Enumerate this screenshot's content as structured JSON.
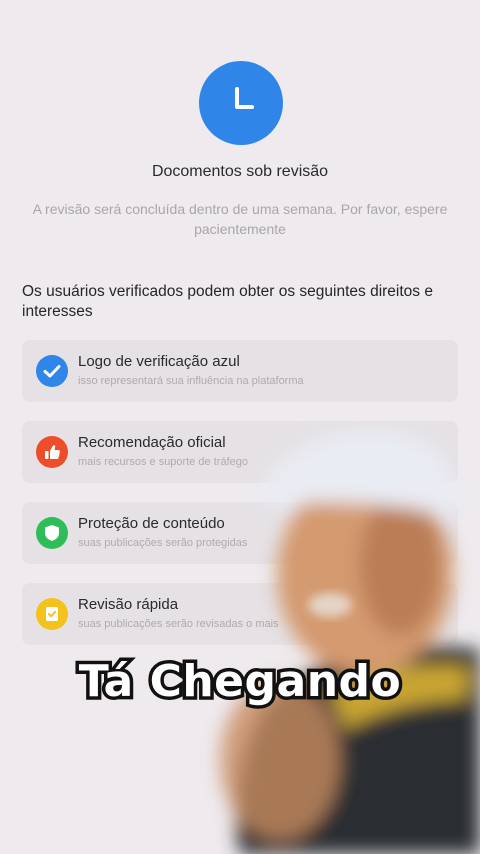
{
  "status": {
    "icon": "clock-icon",
    "title": "Docomentos sob revisão",
    "subtitle": "A revisão será concluída dentro de uma semana. Por favor, espere pacientemente"
  },
  "benefits": {
    "heading": "Os usuários verificados podem obter os seguintes direitos e interesses",
    "items": [
      {
        "icon": "blue-check-icon",
        "color": "#2f86e8",
        "title": "Logo de verificação azul",
        "description": "isso representará sua influência na plataforma"
      },
      {
        "icon": "thumbs-up-icon",
        "color": "#ee4d2a",
        "title": "Recomendação oficial",
        "description": "mais recursos e suporte de tráfego"
      },
      {
        "icon": "shield-icon",
        "color": "#2fbd5a",
        "title": "Proteção de conteúdo",
        "description": "suas publicações serão protegidas"
      },
      {
        "icon": "review-icon",
        "color": "#f3c21c",
        "title": "Revisão rápida",
        "description": "suas publicações serão revisadas o mais"
      }
    ]
  },
  "overlay": {
    "caption": "Tá Chegando"
  }
}
